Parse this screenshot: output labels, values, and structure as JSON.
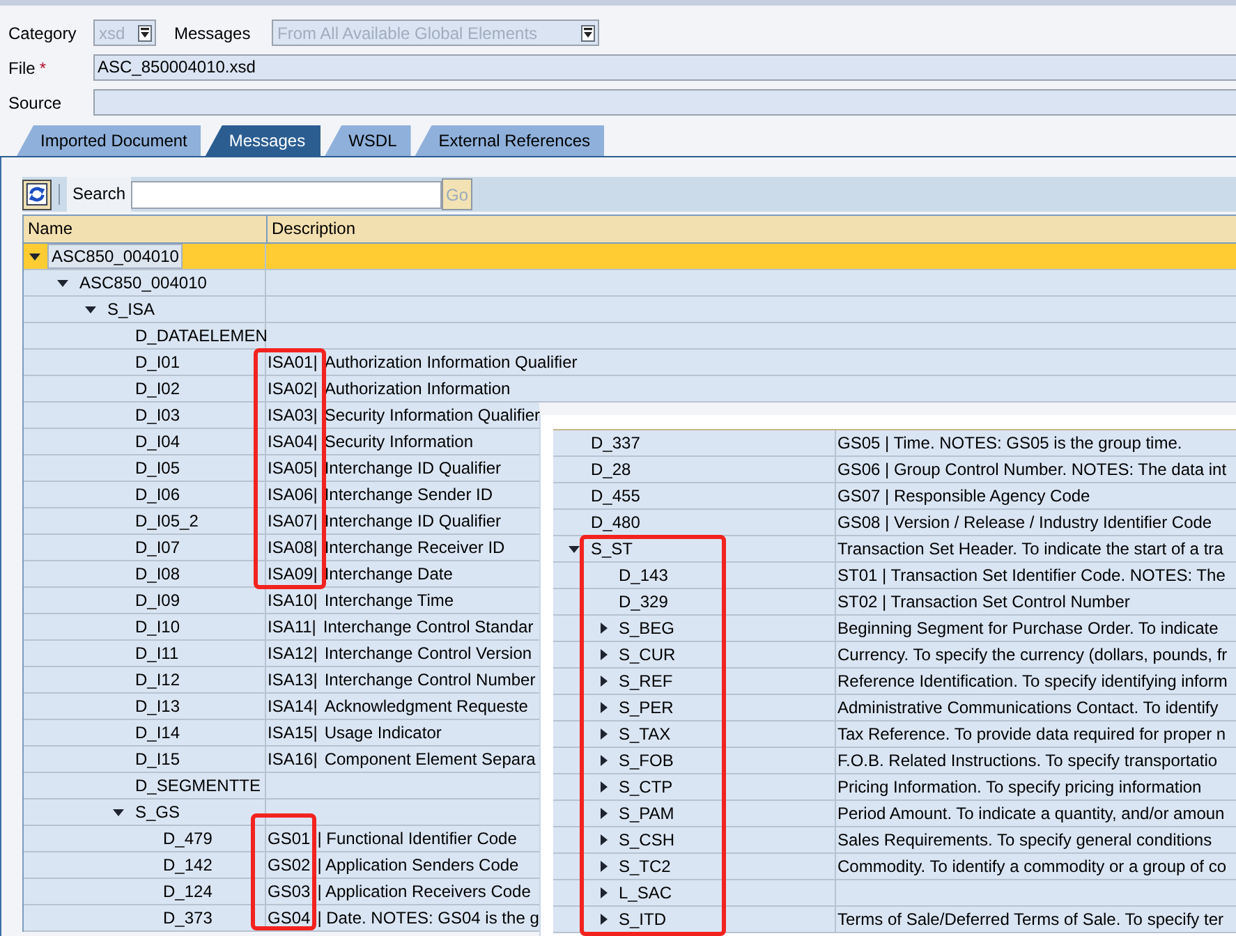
{
  "form": {
    "category": {
      "label": "Category",
      "value": "xsd",
      "disabled": true
    },
    "messages": {
      "label": "Messages",
      "value": "From All Available Global Elements",
      "disabled": true
    },
    "file": {
      "label": "File",
      "required_mark": "*",
      "value": "ASC_850004010.xsd"
    },
    "source": {
      "label": "Source"
    }
  },
  "tabs": [
    {
      "label": "Imported Document",
      "selected": false
    },
    {
      "label": "Messages",
      "selected": true
    },
    {
      "label": "WSDL",
      "selected": false
    },
    {
      "label": "External References",
      "selected": false
    }
  ],
  "toolbar": {
    "search_label": "Search",
    "go_button": {
      "label": "Go",
      "disabled": true
    }
  },
  "tree": {
    "columns": [
      {
        "label": "Name"
      },
      {
        "label": "Description"
      }
    ],
    "rows": [
      {
        "name": "ASC850_004010",
        "selected": true,
        "expanded": true,
        "children": [
          {
            "name": "ASC850_004010",
            "selected": false,
            "expanded": true,
            "children": [
              {
                "name": "S_ISA",
                "selected": false,
                "expanded": true,
                "children": [
                  {
                    "name": "D_DATAELEMEN",
                    "selected": false
                  },
                  {
                    "name": "D_I01",
                    "code": "ISA01|",
                    "description": "Authorization Information Qualifier",
                    "selected": false
                  },
                  {
                    "name": "D_I02",
                    "code": "ISA02|",
                    "description": "Authorization Information",
                    "selected": false
                  },
                  {
                    "name": "D_I03",
                    "code": "ISA03|",
                    "description": "Security Information Qualifier",
                    "selected": false
                  },
                  {
                    "name": "D_I04",
                    "code": "ISA04|",
                    "description": "Security Information",
                    "selected": false
                  },
                  {
                    "name": "D_I05",
                    "code": "ISA05|",
                    "description": "Interchange ID Qualifier",
                    "selected": false
                  },
                  {
                    "name": "D_I06",
                    "code": "ISA06|",
                    "description": "Interchange Sender ID",
                    "selected": false
                  },
                  {
                    "name": "D_I05_2",
                    "code": "ISA07|",
                    "description": "Interchange ID Qualifier",
                    "selected": false
                  },
                  {
                    "name": "D_I07",
                    "code": "ISA08|",
                    "description": "Interchange Receiver ID",
                    "selected": false
                  },
                  {
                    "name": "D_I08",
                    "code": "ISA09|",
                    "description": "Interchange Date",
                    "selected": false
                  },
                  {
                    "name": "D_I09",
                    "code": "ISA10|",
                    "description": "Interchange Time",
                    "selected": false
                  },
                  {
                    "name": "D_I10",
                    "code": "ISA11|",
                    "description": "Interchange Control Standar",
                    "selected": false
                  },
                  {
                    "name": "D_I11",
                    "code": "ISA12|",
                    "description": "Interchange Control Version",
                    "selected": false
                  },
                  {
                    "name": "D_I12",
                    "code": "ISA13|",
                    "description": "Interchange Control Number",
                    "selected": false
                  },
                  {
                    "name": "D_I13",
                    "code": "ISA14|",
                    "description": "Acknowledgment Requeste",
                    "selected": false
                  },
                  {
                    "name": "D_I14",
                    "code": "ISA15|",
                    "description": "Usage Indicator",
                    "selected": false
                  },
                  {
                    "name": "D_I15",
                    "code": "ISA16|",
                    "description": "Component Element Separa",
                    "selected": false
                  },
                  {
                    "name": "D_SEGMENTTE",
                    "selected": false
                  },
                  {
                    "name": "S_GS",
                    "selected": false,
                    "expanded": true,
                    "children": [
                      {
                        "name": "D_479",
                        "code": "GS01",
                        "description": "| Functional Identifier Code",
                        "selected": false
                      },
                      {
                        "name": "D_142",
                        "code": "GS02",
                        "description": "| Application Senders Code",
                        "selected": false
                      },
                      {
                        "name": "D_124",
                        "code": "GS03",
                        "description": "| Application Receivers Code",
                        "selected": false
                      },
                      {
                        "name": "D_373",
                        "code": "GS04",
                        "description": "| Date. NOTES: GS04 is the g",
                        "selected": false
                      }
                    ]
                  }
                ]
              }
            ]
          }
        ]
      }
    ]
  },
  "inset": {
    "rows": [
      {
        "name": "D_337",
        "description": "GS05 | Time. NOTES: GS05 is the group time.",
        "selected": false
      },
      {
        "name": "D_28",
        "description": "GS06 | Group Control Number. NOTES: The data int",
        "selected": false
      },
      {
        "name": "D_455",
        "description": "GS07 | Responsible Agency Code",
        "selected": false
      },
      {
        "name": "D_480",
        "description": "GS08 | Version / Release / Industry Identifier Code",
        "selected": false
      },
      {
        "name": "S_ST",
        "description": "Transaction Set Header. To indicate the start of a tra",
        "selected": false,
        "expanded": true,
        "children": [
          {
            "name": "D_143",
            "description": "ST01 | Transaction Set Identifier Code. NOTES: The",
            "selected": false
          },
          {
            "name": "D_329",
            "description": "ST02 | Transaction Set Control Number",
            "selected": false
          },
          {
            "name": "S_BEG",
            "description": "Beginning Segment for Purchase Order. To indicate",
            "selected": false,
            "expanded": false
          },
          {
            "name": "S_CUR",
            "description": "Currency. To specify the currency (dollars, pounds, fr",
            "selected": false,
            "expanded": false
          },
          {
            "name": "S_REF",
            "description": "Reference Identification. To specify identifying inform",
            "selected": false,
            "expanded": false
          },
          {
            "name": "S_PER",
            "description": "Administrative Communications Contact. To identify",
            "selected": false,
            "expanded": false
          },
          {
            "name": "S_TAX",
            "description": "Tax Reference. To provide data required for proper n",
            "selected": false,
            "expanded": false
          },
          {
            "name": "S_FOB",
            "description": "F.O.B. Related Instructions. To specify transportatio",
            "selected": false,
            "expanded": false
          },
          {
            "name": "S_CTP",
            "description": "Pricing Information. To specify pricing information",
            "selected": false,
            "expanded": false
          },
          {
            "name": "S_PAM",
            "description": "Period Amount. To indicate a quantity, and/or amoun",
            "selected": false,
            "expanded": false
          },
          {
            "name": "S_CSH",
            "description": "Sales Requirements. To specify general conditions",
            "selected": false,
            "expanded": false
          },
          {
            "name": "S_TC2",
            "description": "Commodity. To identify a commodity or a group of co",
            "selected": false,
            "expanded": false
          },
          {
            "name": "L_SAC",
            "selected": false,
            "expanded": false
          },
          {
            "name": "S_ITD",
            "description": "Terms of Sale/Deferred Terms of Sale. To specify ter",
            "selected": false,
            "expanded": false
          }
        ]
      }
    ]
  },
  "annotation_frames": [
    {
      "kind": "rectangle"
    },
    {
      "kind": "rectangle"
    },
    {
      "kind": "rectangle"
    }
  ]
}
